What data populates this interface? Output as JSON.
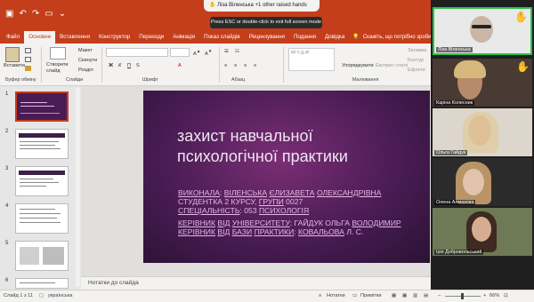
{
  "titlebar": {
    "raised_hands": "Ліза Віленська +1 other raised hands",
    "esc_hint": "Press ESC or double-click to exit full screen mode"
  },
  "ribbon_tabs": [
    "Файл",
    "Основне",
    "Вставлення",
    "Конструктор",
    "Переходи",
    "Анімація",
    "Показ слайдів",
    "Рецензування",
    "Подання",
    "Довідка"
  ],
  "tell_me": "Скажіть, що потрібно зробити",
  "ribbon": {
    "paste": "Вставити",
    "new_slide": "Створити слайд",
    "layout": "Макет",
    "reset": "Скинути",
    "section": "Розділ",
    "arrange": "Упорядкувати",
    "group_clipboard": "Буфер обміну",
    "group_slides": "Слайди",
    "group_font": "Шрифт",
    "group_paragraph": "Абзац",
    "group_drawing": "Малювання",
    "quick_styles": "Експрес-стилі",
    "shape_fill": "Заливка",
    "shape_outline": "Контур",
    "shape_effects": "Ефекти"
  },
  "thumbnails": [
    "1",
    "2",
    "3",
    "4",
    "5",
    "6"
  ],
  "slide": {
    "title_line1": "захист навчальної",
    "title_line2": "психологічної практики",
    "performed": "ВИКОНАЛА",
    "name_1": "ВІЛЕНСЬКА",
    "name_2": "ЄЛИЗАВЕТА",
    "name_3": "ОЛЕКСАНДРІВНА",
    "student": "СТУДЕНТКА 2 КУРСУ,",
    "group": "ГРУПИ",
    "group_no": "0027",
    "specialty": "СПЕЦІАЛЬНІСТЬ",
    "specialty_val": ": 053",
    "psychology": "ПСИХОЛОГІЯ",
    "head_univ_1": "КЕРІВНИК",
    "head_univ_2": "ВІД",
    "head_univ_3": "УНІВЕРСИТЕТУ",
    "head_univ_name": ": ГАЙДУК ОЛЬГА",
    "head_univ_patr": "ВОЛОДИМИР",
    "head_base_1": "КЕРІВНИК",
    "head_base_2": "ВІД",
    "head_base_3": "БАЗИ",
    "head_base_4": "ПРАКТИКИ",
    "head_base_name": "КОВАЛЬОВА",
    "head_base_init": "Л. С."
  },
  "notes_placeholder": "Нотатки до слайда",
  "status": {
    "slide_counter": "Слайд 1 з 11",
    "language": "українська",
    "notes": "Нотатки",
    "comments": "Примітки",
    "zoom": "66%"
  },
  "participants": [
    {
      "name": "Ліза Віленська",
      "hand": "✋"
    },
    {
      "name": "Каріна Колесник",
      "hand": "✋"
    },
    {
      "name": "Ольга Гайдук",
      "hand": ""
    },
    {
      "name": "Олена Алмазова",
      "hand": ""
    },
    {
      "name": "Ірія Добровольський",
      "hand": ""
    }
  ],
  "colors": {
    "accent": "#c43e1c",
    "slide_bg": "#4a1c55",
    "slide_text": "#e6b7e6",
    "active_speaker": "#29c24a"
  }
}
